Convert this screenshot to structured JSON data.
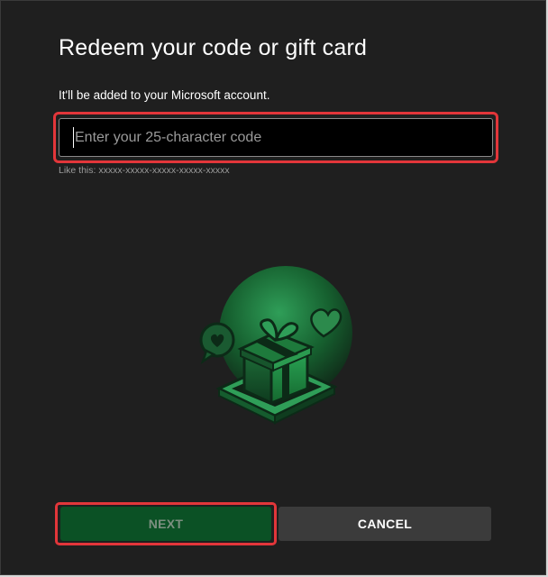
{
  "dialog": {
    "title": "Redeem your code or gift card",
    "subtitle": "It'll be added to your Microsoft account.",
    "code_input": {
      "value": "",
      "placeholder": "Enter your 25-character code"
    },
    "hint": "Like this: xxxxx-xxxxx-xxxxx-xxxxx-xxxxx",
    "illustration_icon": "gift-box-illustration",
    "buttons": {
      "next_label": "NEXT",
      "cancel_label": "CANCEL"
    }
  },
  "colors": {
    "background": "#1f1f1f",
    "input_background": "#000000",
    "next_button": "#0b5125",
    "cancel_button": "#3b3b3b",
    "highlight": "#e2363a",
    "accent_green": "#2e9e5a"
  }
}
